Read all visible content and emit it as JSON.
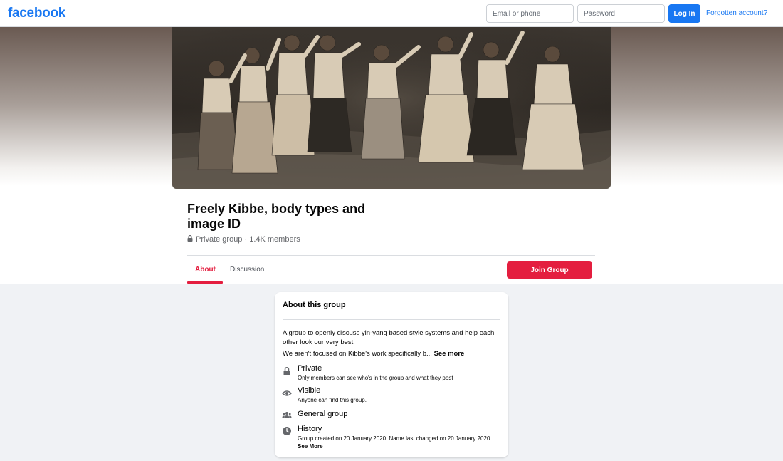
{
  "header": {
    "logo": "facebook",
    "email_placeholder": "Email or phone",
    "password_placeholder": "Password",
    "login_label": "Log In",
    "forgot_label": "Forgotten account?"
  },
  "group": {
    "title": "Freely Kibbe, body types and image ID",
    "meta": "Private group · 1.4K members",
    "tabs": [
      {
        "label": "About",
        "active": true
      },
      {
        "label": "Discussion",
        "active": false
      }
    ],
    "join_label": "Join Group"
  },
  "about": {
    "title": "About this group",
    "description_1": "A group to openly discuss yin-yang based style systems and help each other look our very best!",
    "description_2": "We aren't focused on Kibbe's work specifically b...",
    "see_more": "See more",
    "rows": [
      {
        "icon": "lock-icon",
        "title": "Private",
        "sub": "Only members can see who's in the group and what they post"
      },
      {
        "icon": "eye-icon",
        "title": "Visible",
        "sub": "Anyone can find this group."
      },
      {
        "icon": "people-icon",
        "title": "General group",
        "sub": ""
      },
      {
        "icon": "clock-icon",
        "title": "History",
        "sub": "Group created on 20 January 2020. Name last changed on 20 January 2020.",
        "sub_link": "See More"
      }
    ]
  },
  "colors": {
    "brand": "#1877f2",
    "accent": "#e41e3f",
    "page_bg": "#f0f2f5"
  }
}
